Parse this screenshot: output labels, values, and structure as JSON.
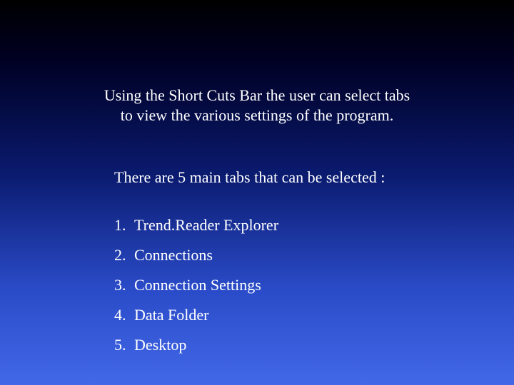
{
  "intro_line1": "Using the Short Cuts Bar the user can select tabs",
  "intro_line2": "to view the various settings of the program.",
  "subhead": "There are 5 main tabs that can be selected :",
  "tabs": [
    "Trend.Reader Explorer",
    "Connections",
    "Connection Settings",
    "Data Folder",
    "Desktop"
  ]
}
